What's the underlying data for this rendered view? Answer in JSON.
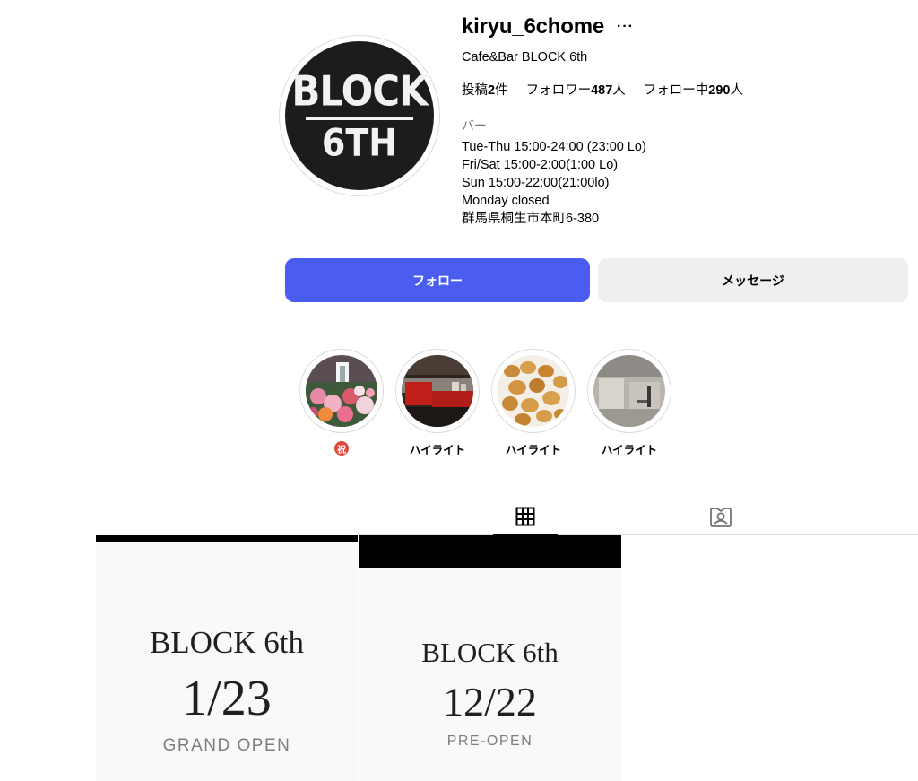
{
  "profile": {
    "username": "kiryu_6chome",
    "full_name": "Cafe&Bar BLOCK 6th",
    "avatar_logo": {
      "top": "BLOCK",
      "bottom": "6TH"
    },
    "stats": {
      "posts_prefix": "投稿",
      "posts_count": "2",
      "posts_suffix": "件",
      "followers_prefix": "フォロワー",
      "followers_count": "487",
      "followers_suffix": "人",
      "following_prefix": "フォロー中",
      "following_count": "290",
      "following_suffix": "人"
    },
    "category": "バー",
    "bio_lines": [
      "Tue-Thu 15:00-24:00 (23:00 Lo)",
      "Fri/Sat 15:00-2:00(1:00 Lo)",
      "Sun 15:00-22:00(21:00lo)",
      "Monday closed",
      "群馬県桐生市本町6-380"
    ]
  },
  "buttons": {
    "follow": "フォロー",
    "message": "メッセージ"
  },
  "highlights": [
    {
      "label": "",
      "badge": "祝"
    },
    {
      "label": "ハイライト"
    },
    {
      "label": "ハイライト"
    },
    {
      "label": "ハイライト"
    }
  ],
  "tabs": [
    {
      "icon": "grid-icon"
    },
    {
      "icon": "tagged-icon"
    }
  ],
  "posts": [
    {
      "brand": "BLOCK 6th",
      "date": "1/23",
      "subtitle": "GRAND OPEN"
    },
    {
      "brand": "BLOCK 6th",
      "date": "12/22",
      "subtitle": "PRE-OPEN"
    }
  ],
  "colors": {
    "follow_button": "#4a5df0",
    "message_button": "#efefef",
    "avatar_bg": "#1c1c1c",
    "badge": "#e0463a"
  }
}
